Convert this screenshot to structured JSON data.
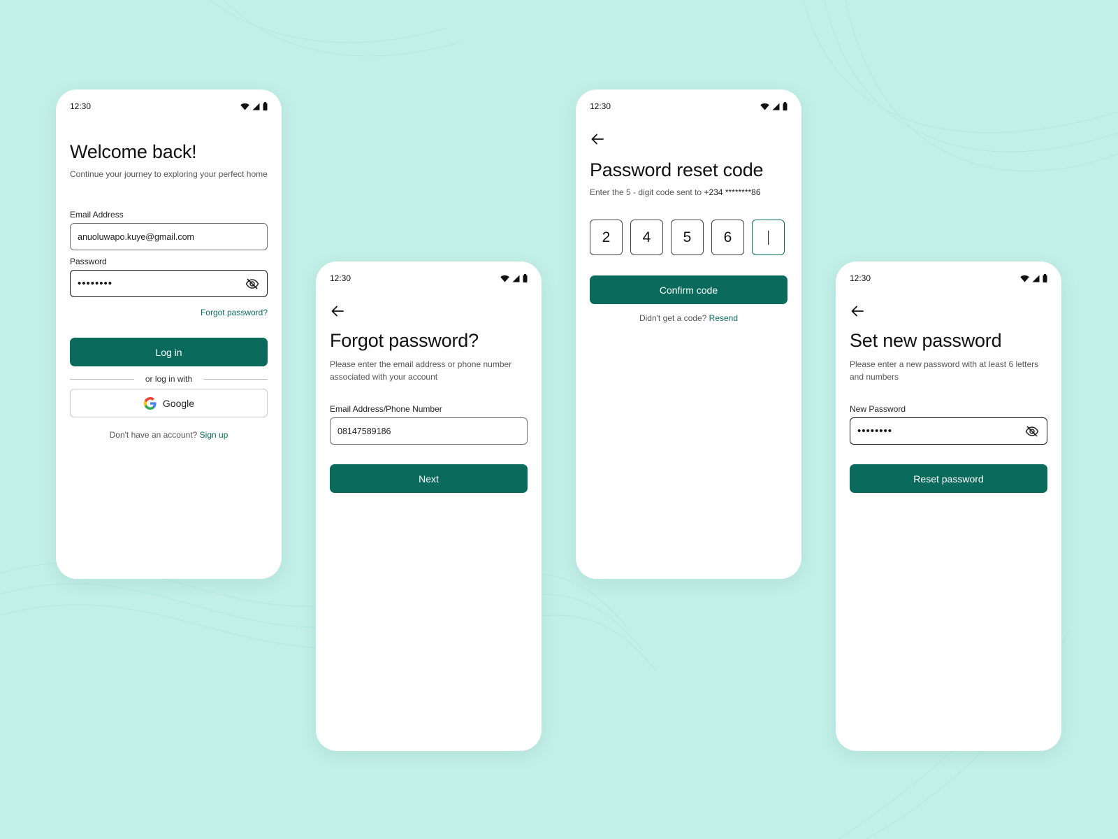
{
  "colors": {
    "background": "#c2efe7",
    "accent": "#0a6b5c",
    "card": "#ffffff"
  },
  "status_bar": {
    "time": "12:30",
    "icons": [
      "wifi-icon",
      "cellular-signal-icon",
      "battery-icon"
    ]
  },
  "login": {
    "title": "Welcome back!",
    "subtitle": "Continue your journey to exploring your perfect home",
    "email_label": "Email Address",
    "email_value": "anuoluwapo.kuye@gmail.com",
    "password_label": "Password",
    "password_value": "••••••••",
    "forgot_link": "Forgot password?",
    "login_button": "Log in",
    "divider_text": "or log in with",
    "google_button": "Google",
    "signup_prompt": "Don't have an account?",
    "signup_link": "Sign up"
  },
  "forgot": {
    "title": "Forgot password?",
    "subtitle": "Please enter the email address or phone number associated with your account",
    "field_label": "Email Address/Phone Number",
    "field_value": "08147589186",
    "next_button": "Next"
  },
  "reset_code": {
    "title": "Password reset code",
    "subtitle_prefix": "Enter the 5 - digit code sent to",
    "phone_masked": "+234 ********86",
    "digits": [
      "2",
      "4",
      "5",
      "6",
      ""
    ],
    "confirm_button": "Confirm code",
    "resend_prompt": "Didn't get a code?",
    "resend_link": "Resend"
  },
  "new_password": {
    "title": "Set new password",
    "subtitle": "Please enter a new password with at least 6 letters and numbers",
    "field_label": "New Password",
    "field_value": "••••••••",
    "reset_button": "Reset password"
  }
}
